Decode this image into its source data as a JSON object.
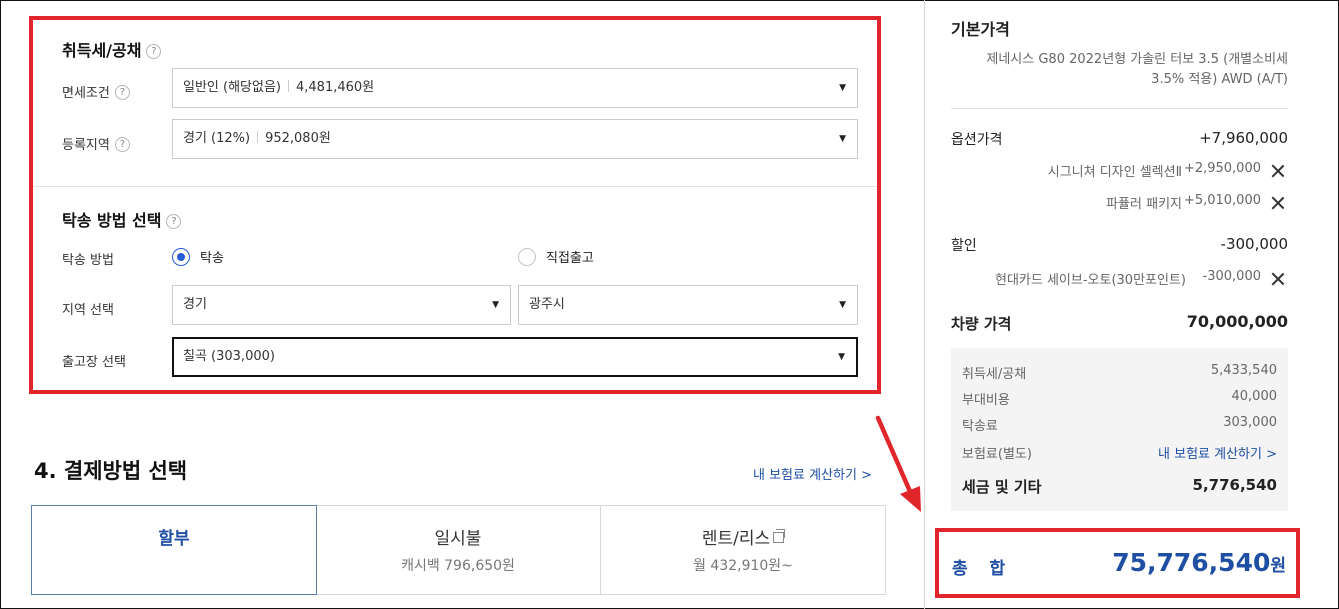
{
  "tax": {
    "title": "취득세/공채",
    "exemption_label": "면세조건",
    "exemption_value": "일반인 (해당없음)",
    "exemption_amount": "4,481,460원",
    "region_label": "등록지역",
    "region_value": "경기 (12%)",
    "region_amount": "952,080원"
  },
  "delivery": {
    "title": "탁송 방법 선택",
    "method_label": "탁송 방법",
    "option1": "탁송",
    "option2": "직접출고",
    "area_label": "지역 선택",
    "area_value": "경기",
    "city_value": "광주시",
    "factory_label": "출고장 선택",
    "factory_value": "칠곡 (303,000)"
  },
  "payment": {
    "title": "4. 결제방법 선택",
    "insurance_link": "내 보험료 계산하기 >",
    "tabs": [
      {
        "label": "할부",
        "sub": ""
      },
      {
        "label": "일시불",
        "sub": "캐시백 796,650원"
      },
      {
        "label": "렌트/리스",
        "sub": "월 432,910원~"
      }
    ]
  },
  "summary": {
    "base_title": "기본가격",
    "base_desc1": "제네시스 G80 2022년형 가솔린 터보 3.5 (개별소비세",
    "base_desc2": "3.5% 적용) AWD (A/T)",
    "option_label": "옵션가격",
    "option_total": "+7,960,000",
    "options": [
      {
        "name": "시그니쳐 디자인 셀렉션Ⅱ",
        "price": "+2,950,000"
      },
      {
        "name": "파퓰러 패키지",
        "price": "+5,010,000"
      }
    ],
    "discount_label": "할인",
    "discount_total": "-300,000",
    "discount_item_name": "현대카드 세이브-오토(30만포인트)",
    "discount_item_price": "-300,000",
    "car_price_label": "차량 가격",
    "car_price": "70,000,000",
    "taxes": [
      {
        "name": "취득세/공채",
        "value": "5,433,540"
      },
      {
        "name": "부대비용",
        "value": "40,000"
      },
      {
        "name": "탁송료",
        "value": "303,000"
      }
    ],
    "insurance_label": "보험료(별도)",
    "insurance_link": "내 보험료 계산하기 >",
    "tax_total_label": "세금 및 기타",
    "tax_total": "5,776,540",
    "total_label": "총 합",
    "total_value": "75,776,540",
    "total_unit": "원"
  },
  "colors": {
    "highlight": "#e0262b",
    "accent": "#1f4fa3"
  }
}
